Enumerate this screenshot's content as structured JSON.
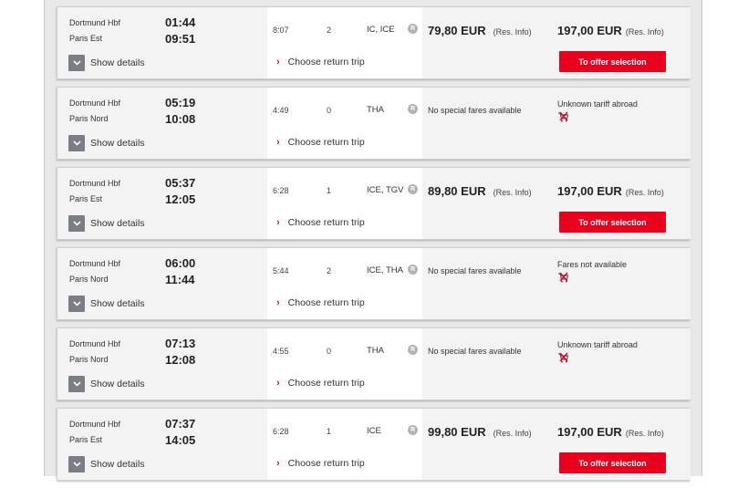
{
  "show_details_label": "Show details",
  "choose_return_label": "Choose return trip",
  "res_info_label": "(Res. Info)",
  "reservation_badge": "R",
  "offer_button_label": "To offer selection",
  "colors": {
    "accent_red": "#e8001c",
    "chevron_box": "#7a7e86"
  },
  "connections": [
    {
      "from": "Dortmund Hbf",
      "to": "Paris Est",
      "dep": "01:44",
      "arr": "09:51",
      "duration": "8:07",
      "changes": "2",
      "products": "IC, ICE",
      "fare1": {
        "type": "price",
        "amount": "79,80 EUR"
      },
      "fare2": {
        "type": "price",
        "amount": "197,00 EUR"
      },
      "has_offer_button": true
    },
    {
      "from": "Dortmund Hbf",
      "to": "Paris Nord",
      "dep": "05:19",
      "arr": "10:08",
      "duration": "4:49",
      "changes": "0",
      "products": "THA",
      "fare1": {
        "type": "text",
        "text": "No special fares available"
      },
      "fare2": {
        "type": "note",
        "text": "Unknown tariff abroad",
        "icon": "cart-unavailable-icon"
      },
      "has_offer_button": false
    },
    {
      "from": "Dortmund Hbf",
      "to": "Paris Est",
      "dep": "05:37",
      "arr": "12:05",
      "duration": "6:28",
      "changes": "1",
      "products": "ICE, TGV",
      "fare1": {
        "type": "price",
        "amount": "89,80 EUR"
      },
      "fare2": {
        "type": "price",
        "amount": "197,00 EUR"
      },
      "has_offer_button": true
    },
    {
      "from": "Dortmund Hbf",
      "to": "Paris Nord",
      "dep": "06:00",
      "arr": "11:44",
      "duration": "5:44",
      "changes": "2",
      "products": "ICE, THA",
      "fare1": {
        "type": "text",
        "text": "No special fares available"
      },
      "fare2": {
        "type": "note",
        "text": "Fares not available",
        "icon": "cart-unavailable-icon"
      },
      "has_offer_button": false
    },
    {
      "from": "Dortmund Hbf",
      "to": "Paris Nord",
      "dep": "07:13",
      "arr": "12:08",
      "duration": "4:55",
      "changes": "0",
      "products": "THA",
      "fare1": {
        "type": "text",
        "text": "No special fares available"
      },
      "fare2": {
        "type": "note",
        "text": "Unknown tariff abroad",
        "icon": "cart-unavailable-icon"
      },
      "has_offer_button": false
    },
    {
      "from": "Dortmund Hbf",
      "to": "Paris Est",
      "dep": "07:37",
      "arr": "14:05",
      "duration": "6:28",
      "changes": "1",
      "products": "ICE",
      "fare1": {
        "type": "price",
        "amount": "99,80 EUR"
      },
      "fare2": {
        "type": "price",
        "amount": "197,00 EUR"
      },
      "has_offer_button": true
    }
  ]
}
